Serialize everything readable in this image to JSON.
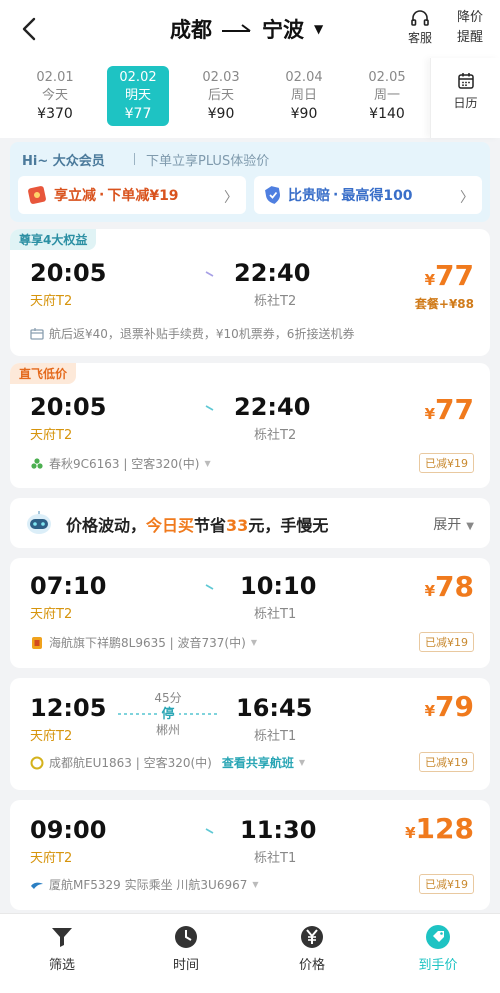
{
  "header": {
    "from": "成都",
    "to": "宁波",
    "service_label": "客服",
    "price_alert_label": "降价\n提醒",
    "price_alert_line1": "降价",
    "price_alert_line2": "提醒"
  },
  "dates": [
    {
      "date": "02.01",
      "day": "今天",
      "price": "¥370"
    },
    {
      "date": "02.02",
      "day": "明天",
      "price": "¥77",
      "selected": true
    },
    {
      "date": "02.03",
      "day": "后天",
      "price": "¥90"
    },
    {
      "date": "02.04",
      "day": "周日",
      "price": "¥90"
    },
    {
      "date": "02.05",
      "day": "周一",
      "price": "¥140"
    }
  ],
  "calendar_label": "日历",
  "member": {
    "greeting": "Hi~ 大众会员",
    "plus_text": "下单立享PLUS体验价",
    "coupon1_title": "享立减",
    "coupon1_dot": "·",
    "coupon1_detail": "下单减¥19",
    "coupon2_title": "比贵赔",
    "coupon2_dot": "·",
    "coupon2_detail": "最高得100"
  },
  "flights": [
    {
      "tag": "尊享4大权益",
      "dep_time": "20:05",
      "dep_airport": "天府T2",
      "arr_time": "22:40",
      "arr_airport": "栎社T2",
      "price_yen": "¥",
      "price": "77",
      "package": "套餐+¥88",
      "info": "航后返¥40，退票补贴手续费，¥10机票券，6折接送机券"
    },
    {
      "tag": "直飞低价",
      "dep_time": "20:05",
      "dep_airport": "天府T2",
      "arr_time": "22:40",
      "arr_airport": "栎社T2",
      "price_yen": "¥",
      "price": "77",
      "airline": "春秋9C6163 | 空客320(中)",
      "reduce": "已减¥19"
    },
    {
      "dep_time": "07:10",
      "dep_airport": "天府T2",
      "arr_time": "10:10",
      "arr_airport": "栎社T1",
      "price_yen": "¥",
      "price": "78",
      "airline": "海航旗下祥鹏8L9635 | 波音737(中)",
      "reduce": "已减¥19"
    },
    {
      "dep_time": "12:05",
      "dep_airport": "天府T2",
      "arr_time": "16:45",
      "arr_airport": "栎社T1",
      "stop_duration": "45分",
      "stop_label": "停",
      "stop_city": "郴州",
      "price_yen": "¥",
      "price": "79",
      "airline": "成都航EU1863 | 空客320(中)",
      "share_link": "查看共享航班",
      "reduce": "已减¥19"
    },
    {
      "dep_time": "09:00",
      "dep_airport": "天府T2",
      "arr_time": "11:30",
      "arr_airport": "栎社T1",
      "price_yen": "¥",
      "price": "128",
      "airline": "厦航MF5329 实际乘坐 川航3U6967",
      "reduce": "已减¥19"
    }
  ],
  "trend": {
    "prefix": "价格波动，",
    "highlight": "今日买",
    "mid": "节省",
    "amount": "33",
    "suffix": "元，手慢无",
    "expand_label": "展开"
  },
  "tabs": [
    {
      "label": "筛选",
      "icon": "filter-icon"
    },
    {
      "label": "时间",
      "icon": "clock-icon"
    },
    {
      "label": "价格",
      "icon": "yen-icon"
    },
    {
      "label": "到手价",
      "icon": "tag-icon",
      "active": true
    }
  ],
  "colors": {
    "accent": "#1ec3c3",
    "price": "#f07a1d",
    "dep_airport": "#d6940c"
  }
}
